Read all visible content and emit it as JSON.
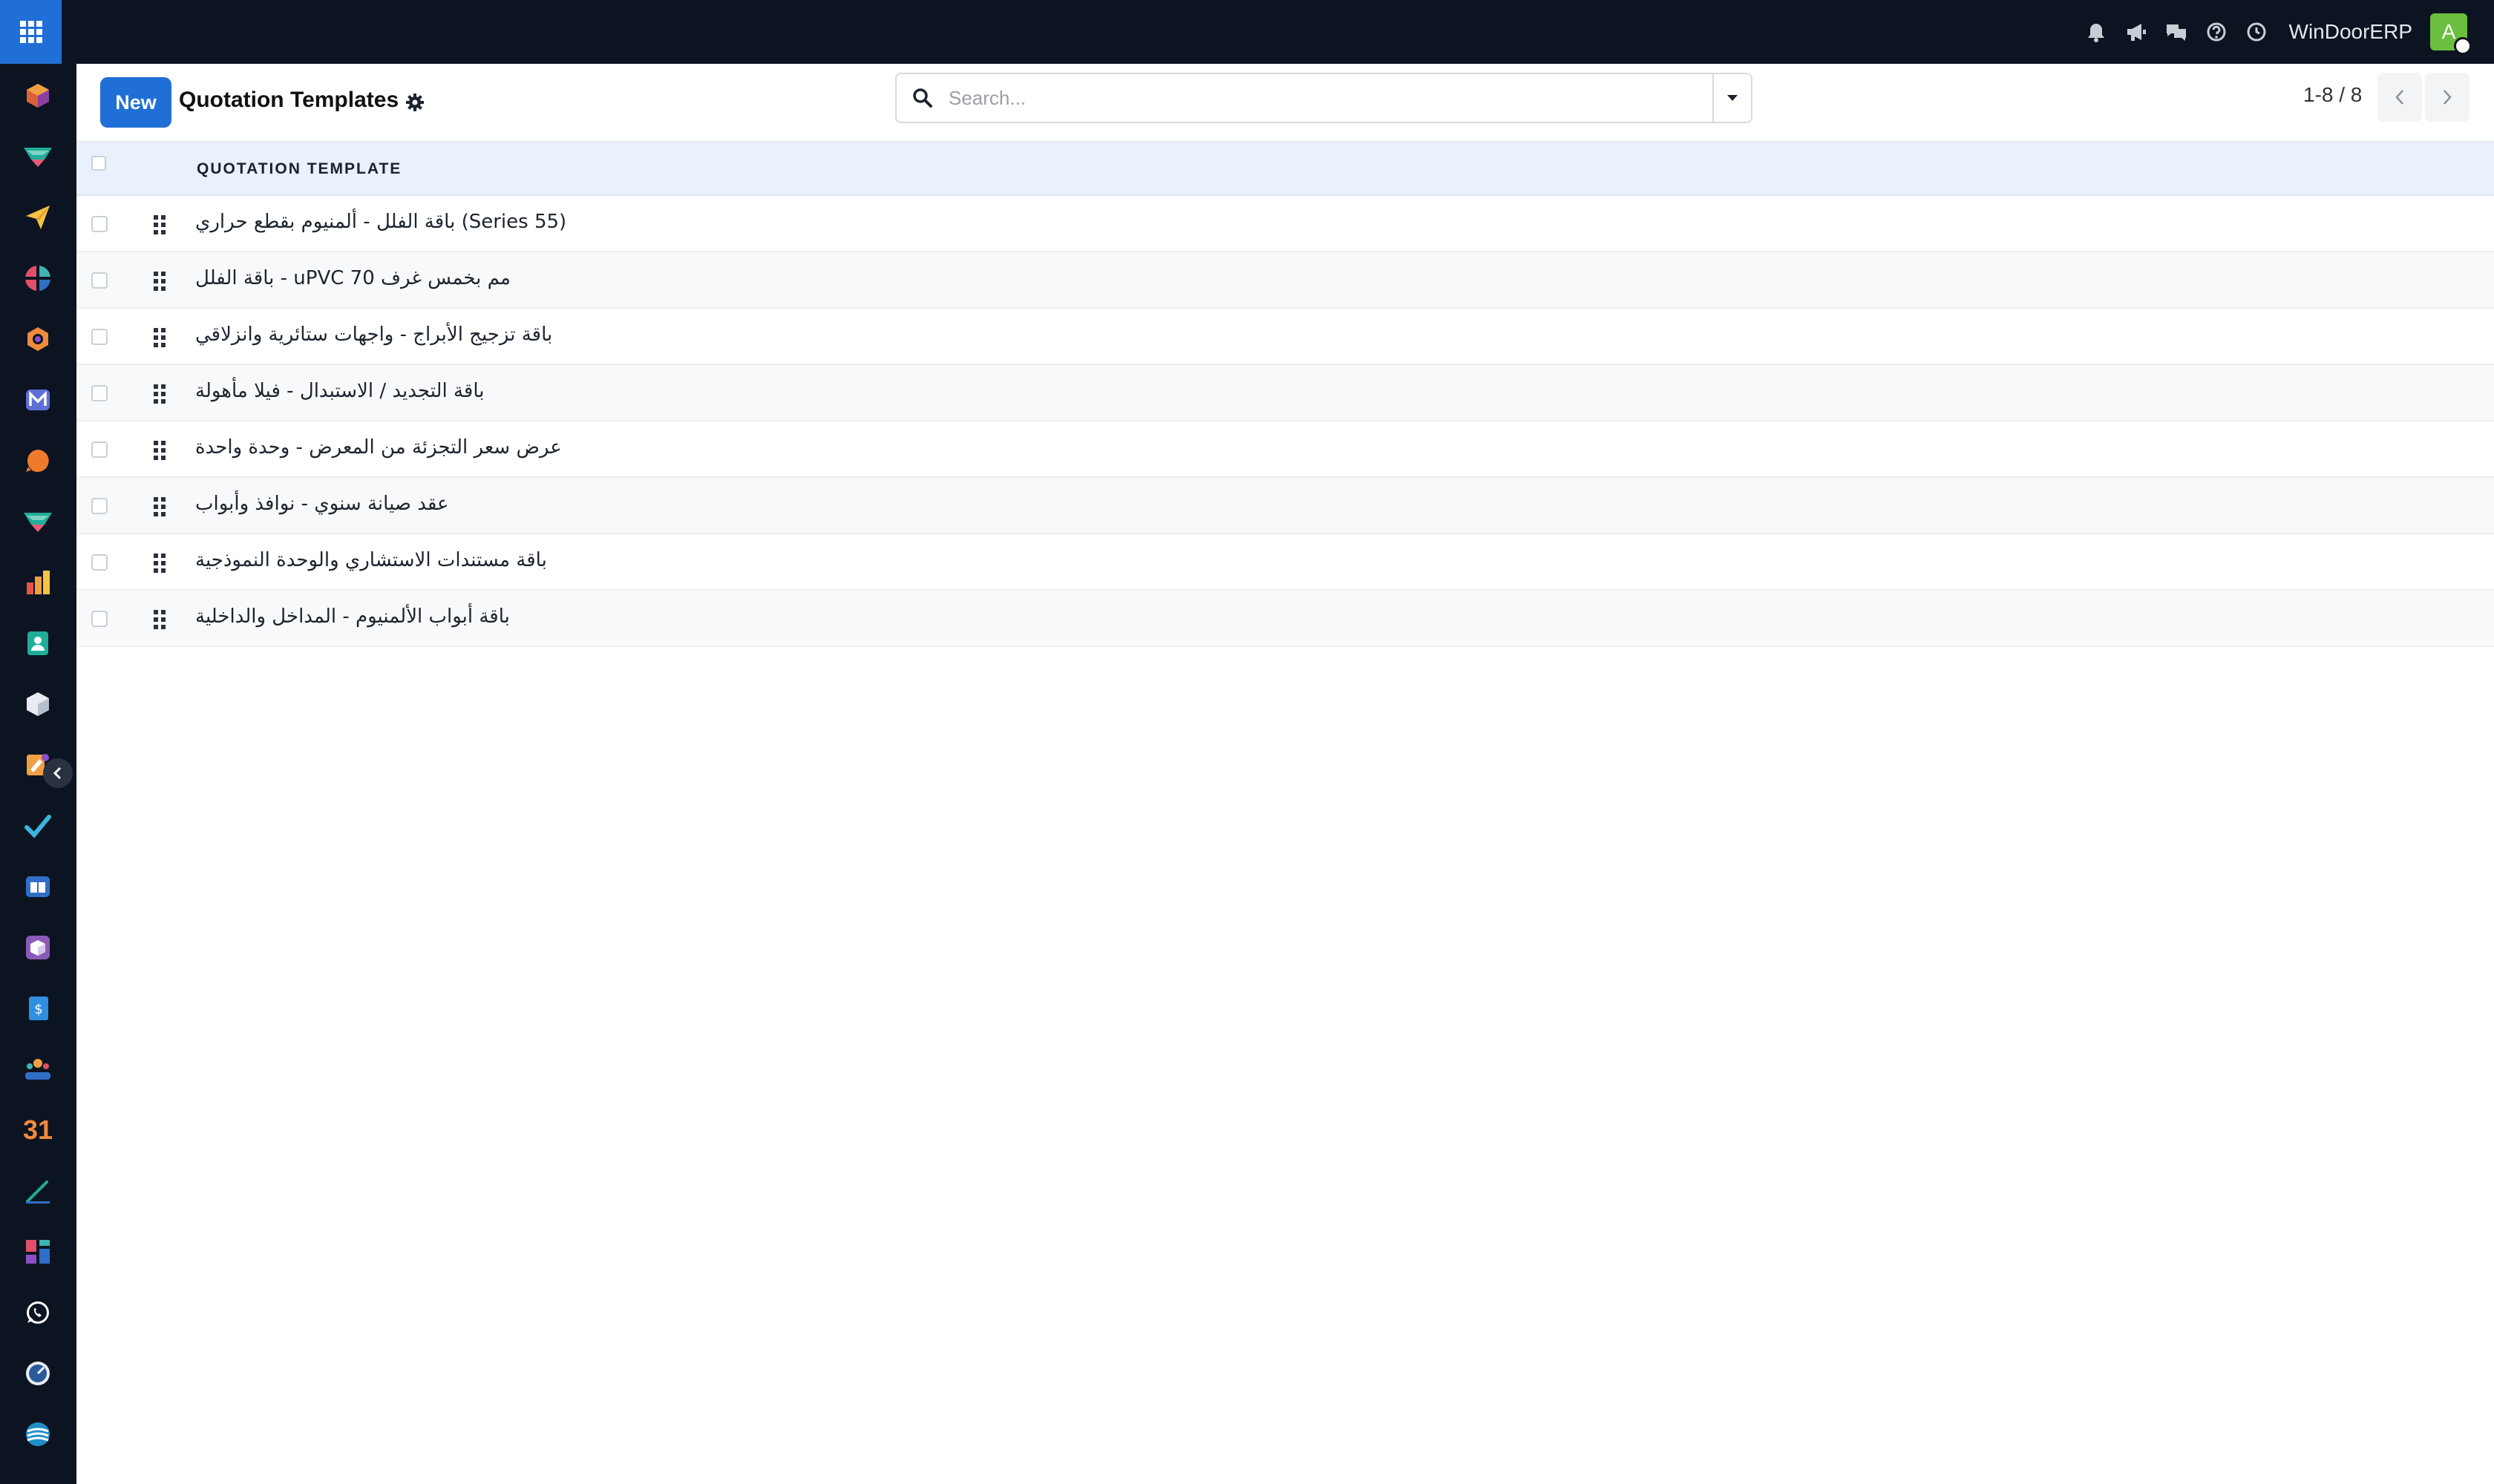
{
  "topbar": {
    "company": "WinDoorERP",
    "avatar_initial": "A",
    "icons": [
      "bell-icon",
      "megaphone-icon",
      "chat-icon",
      "help-icon",
      "clock-icon"
    ]
  },
  "sidebar": {
    "apps_icon": "grid-apps-icon",
    "calendar_label": "31"
  },
  "control": {
    "new_label": "New",
    "title": "Quotation Templates",
    "search_placeholder": "Search...",
    "pager": "1-8 / 8"
  },
  "list": {
    "column_header": "QUOTATION TEMPLATE",
    "rows": [
      "باقة الفلل - ألمنيوم بقطع حراري (Series 55)",
      "باقة الفلل - uPVC 70 مم بخمس غرف",
      "باقة تزجيج الأبراج - واجهات ستائرية وانزلاقي",
      "باقة التجديد / الاستبدال - فيلا مأهولة",
      "عرض سعر التجزئة من المعرض - وحدة واحدة",
      "عقد صيانة سنوي - نوافذ وأبواب",
      "باقة مستندات الاستشاري والوحدة النموذجية",
      "باقة أبواب الألمنيوم - المداخل والداخلية"
    ]
  },
  "colors": {
    "navbar": "#0d1421",
    "accent": "#1f6fd6",
    "header_bg": "#e9f1fd",
    "avatar": "#6abf3f"
  }
}
